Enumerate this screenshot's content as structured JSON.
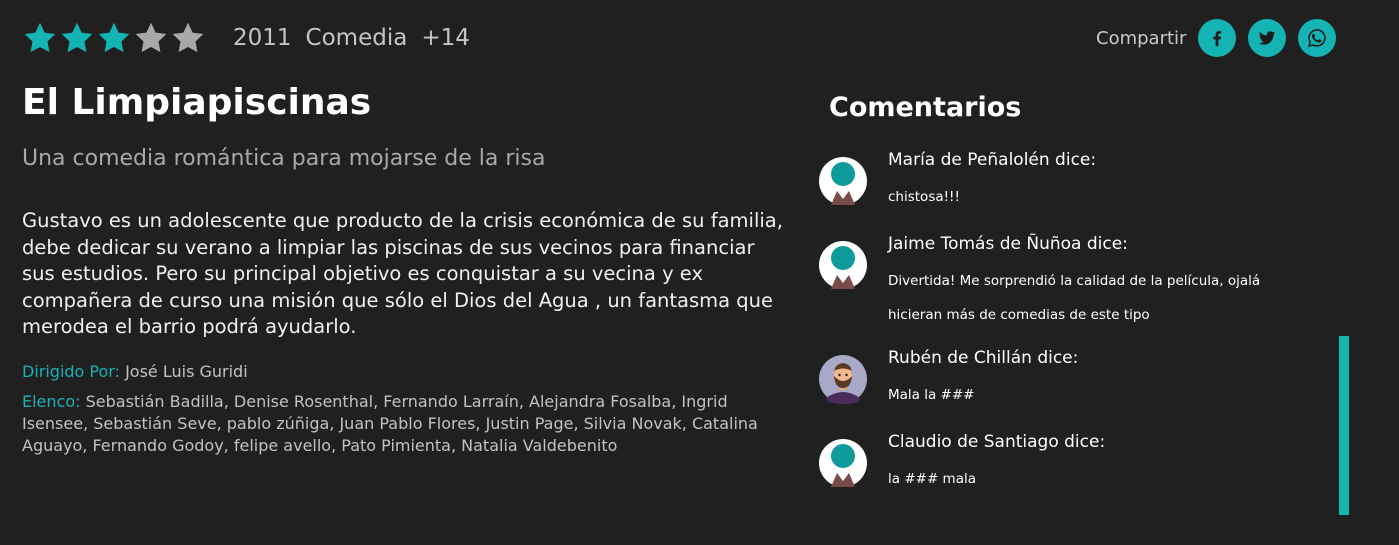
{
  "rating": {
    "value": 3,
    "max": 5,
    "filled_color": "#14b3b4",
    "empty_color": "#a8a8a8"
  },
  "movie": {
    "year": "2011",
    "genre": "Comedia",
    "age_rating": "+14",
    "title": "El Limpiapiscinas",
    "tagline": "Una comedia romántica para mojarse de la risa",
    "synopsis": "Gustavo es un adolescente que producto de la crisis económica de su familia, debe dedicar su verano a limpiar las piscinas de sus vecinos para financiar sus estudios. Pero su principal objetivo es conquistar a su vecina y ex compañera de curso una misión que sólo el Dios del Agua , un fantasma que merodea el barrio podrá ayudarlo.",
    "director_label": "Dirigido Por:",
    "director": "José Luis Guridi",
    "cast_label": "Elenco:",
    "cast": "Sebastián Badilla, Denise Rosenthal, Fernando Larraín, Alejandra Fosalba, Ingrid Isensee, Sebastián Seve, pablo zúñiga, Juan Pablo Flores, Justin Page, Silvia Novak, Catalina Aguayo, Fernando Godoy, felipe avello, Pato Pimienta, Natalia Valdebenito"
  },
  "share": {
    "label": "Compartir",
    "buttons": [
      {
        "icon": "facebook-icon"
      },
      {
        "icon": "twitter-icon"
      },
      {
        "icon": "whatsapp-icon"
      }
    ],
    "accent_color": "#14b3b4"
  },
  "comments": {
    "title": "Comentarios",
    "items": [
      {
        "author": "María de Peñalolén dice:",
        "text": "chistosa!!!",
        "avatar": "default-avatar-icon"
      },
      {
        "author": "Jaime Tomás de Ñuñoa dice:",
        "text": "Divertida! Me sorprendió la calidad de la película, ojalá hicieran más de comedias de este tipo",
        "avatar": "default-avatar-icon"
      },
      {
        "author": "Rubén de Chillán dice:",
        "text": "Mala la ###",
        "avatar": "bearded-man-avatar-icon"
      },
      {
        "author": "Claudio de Santiago dice:",
        "text": "la ### mala",
        "avatar": "default-avatar-icon"
      }
    ]
  }
}
